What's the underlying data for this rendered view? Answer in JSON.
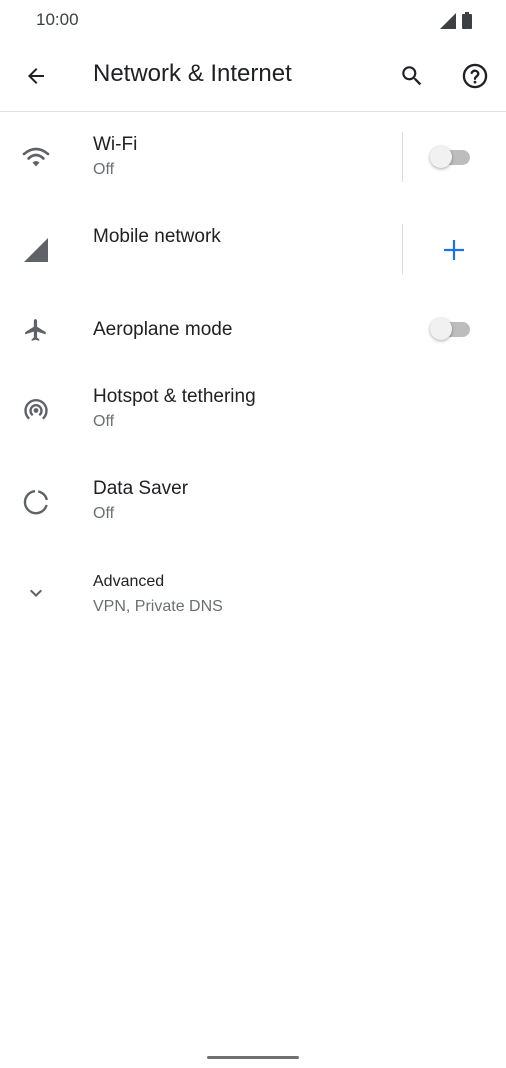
{
  "status_bar": {
    "time": "10:00"
  },
  "app_bar": {
    "title": "Network & Internet"
  },
  "items": [
    {
      "title": "Wi-Fi",
      "subtitle": "Off",
      "toggle_on": false
    },
    {
      "title": "Mobile network"
    },
    {
      "title": "Aeroplane mode",
      "toggle_on": false
    },
    {
      "title": "Hotspot & tethering",
      "subtitle": "Off"
    },
    {
      "title": "Data Saver",
      "subtitle": "Off"
    },
    {
      "title": "Advanced",
      "subtitle": "VPN, Private DNS"
    }
  ],
  "icons": [
    "signal-icon",
    "battery-icon",
    "back-arrow-icon",
    "search-icon",
    "help-icon",
    "wifi-icon",
    "mobile-signal-icon",
    "add-icon",
    "airplane-icon",
    "hotspot-icon",
    "data-saver-icon",
    "chevron-down-icon"
  ],
  "colors": {
    "accent": "#1a73e8",
    "icon_gray": "#5f6368",
    "text_primary": "#202124",
    "text_secondary": "#6b6f73"
  }
}
